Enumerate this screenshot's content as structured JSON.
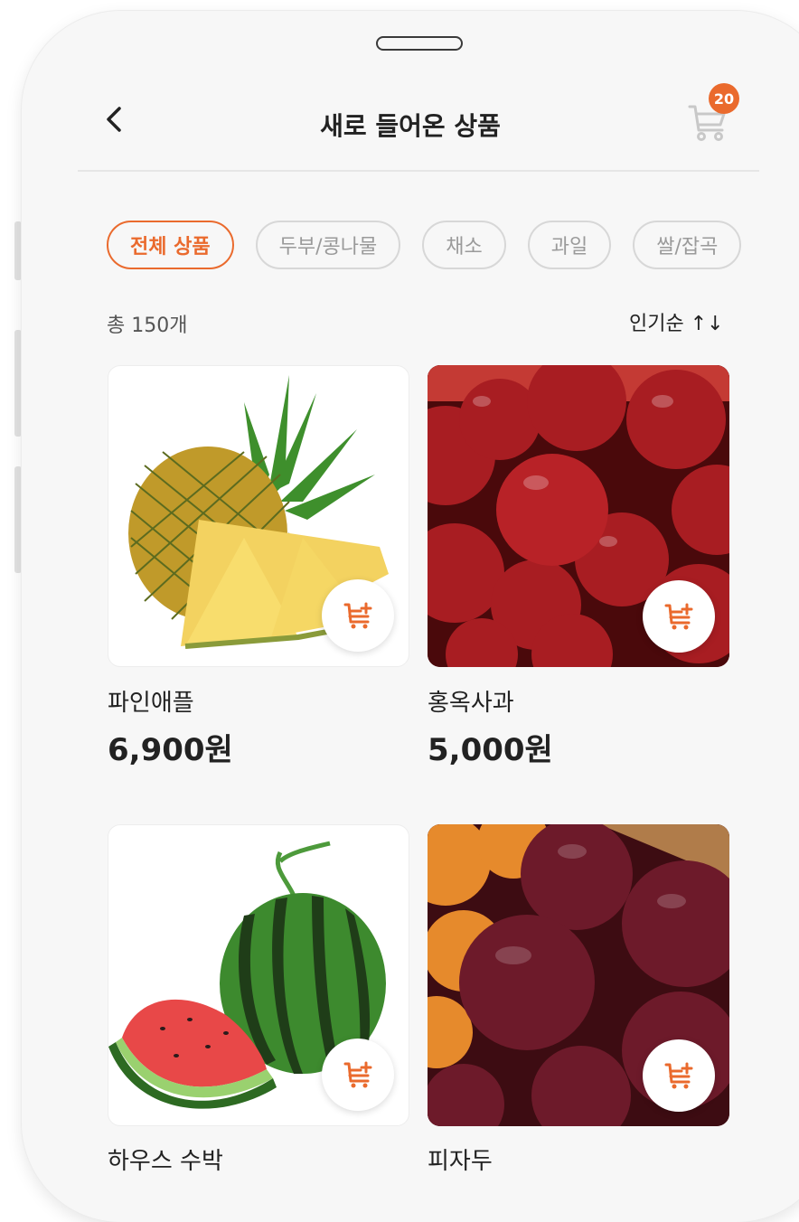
{
  "header": {
    "title": "새로 들어온 상품",
    "cart_count": "20"
  },
  "categories": [
    "전체 상품",
    "두부/콩나물",
    "채소",
    "과일",
    "쌀/잡곡"
  ],
  "summary": {
    "total": "총 150개",
    "sort_label": "인기순 ↑↓"
  },
  "products": [
    {
      "name": "파인애플",
      "price": "6,900원",
      "image": "pineapple"
    },
    {
      "name": "홍옥사과",
      "price": "5,000원",
      "image": "red-apples"
    },
    {
      "name": "하우스 수박",
      "price": "",
      "image": "watermelon"
    },
    {
      "name": "피자두",
      "price": "",
      "image": "red-plums"
    }
  ],
  "colors": {
    "accent": "#ea6a2d",
    "background": "#f7f7f7"
  },
  "icons": [
    "back-arrow-icon",
    "cart-icon",
    "sort-icon",
    "add-to-cart-icon"
  ]
}
